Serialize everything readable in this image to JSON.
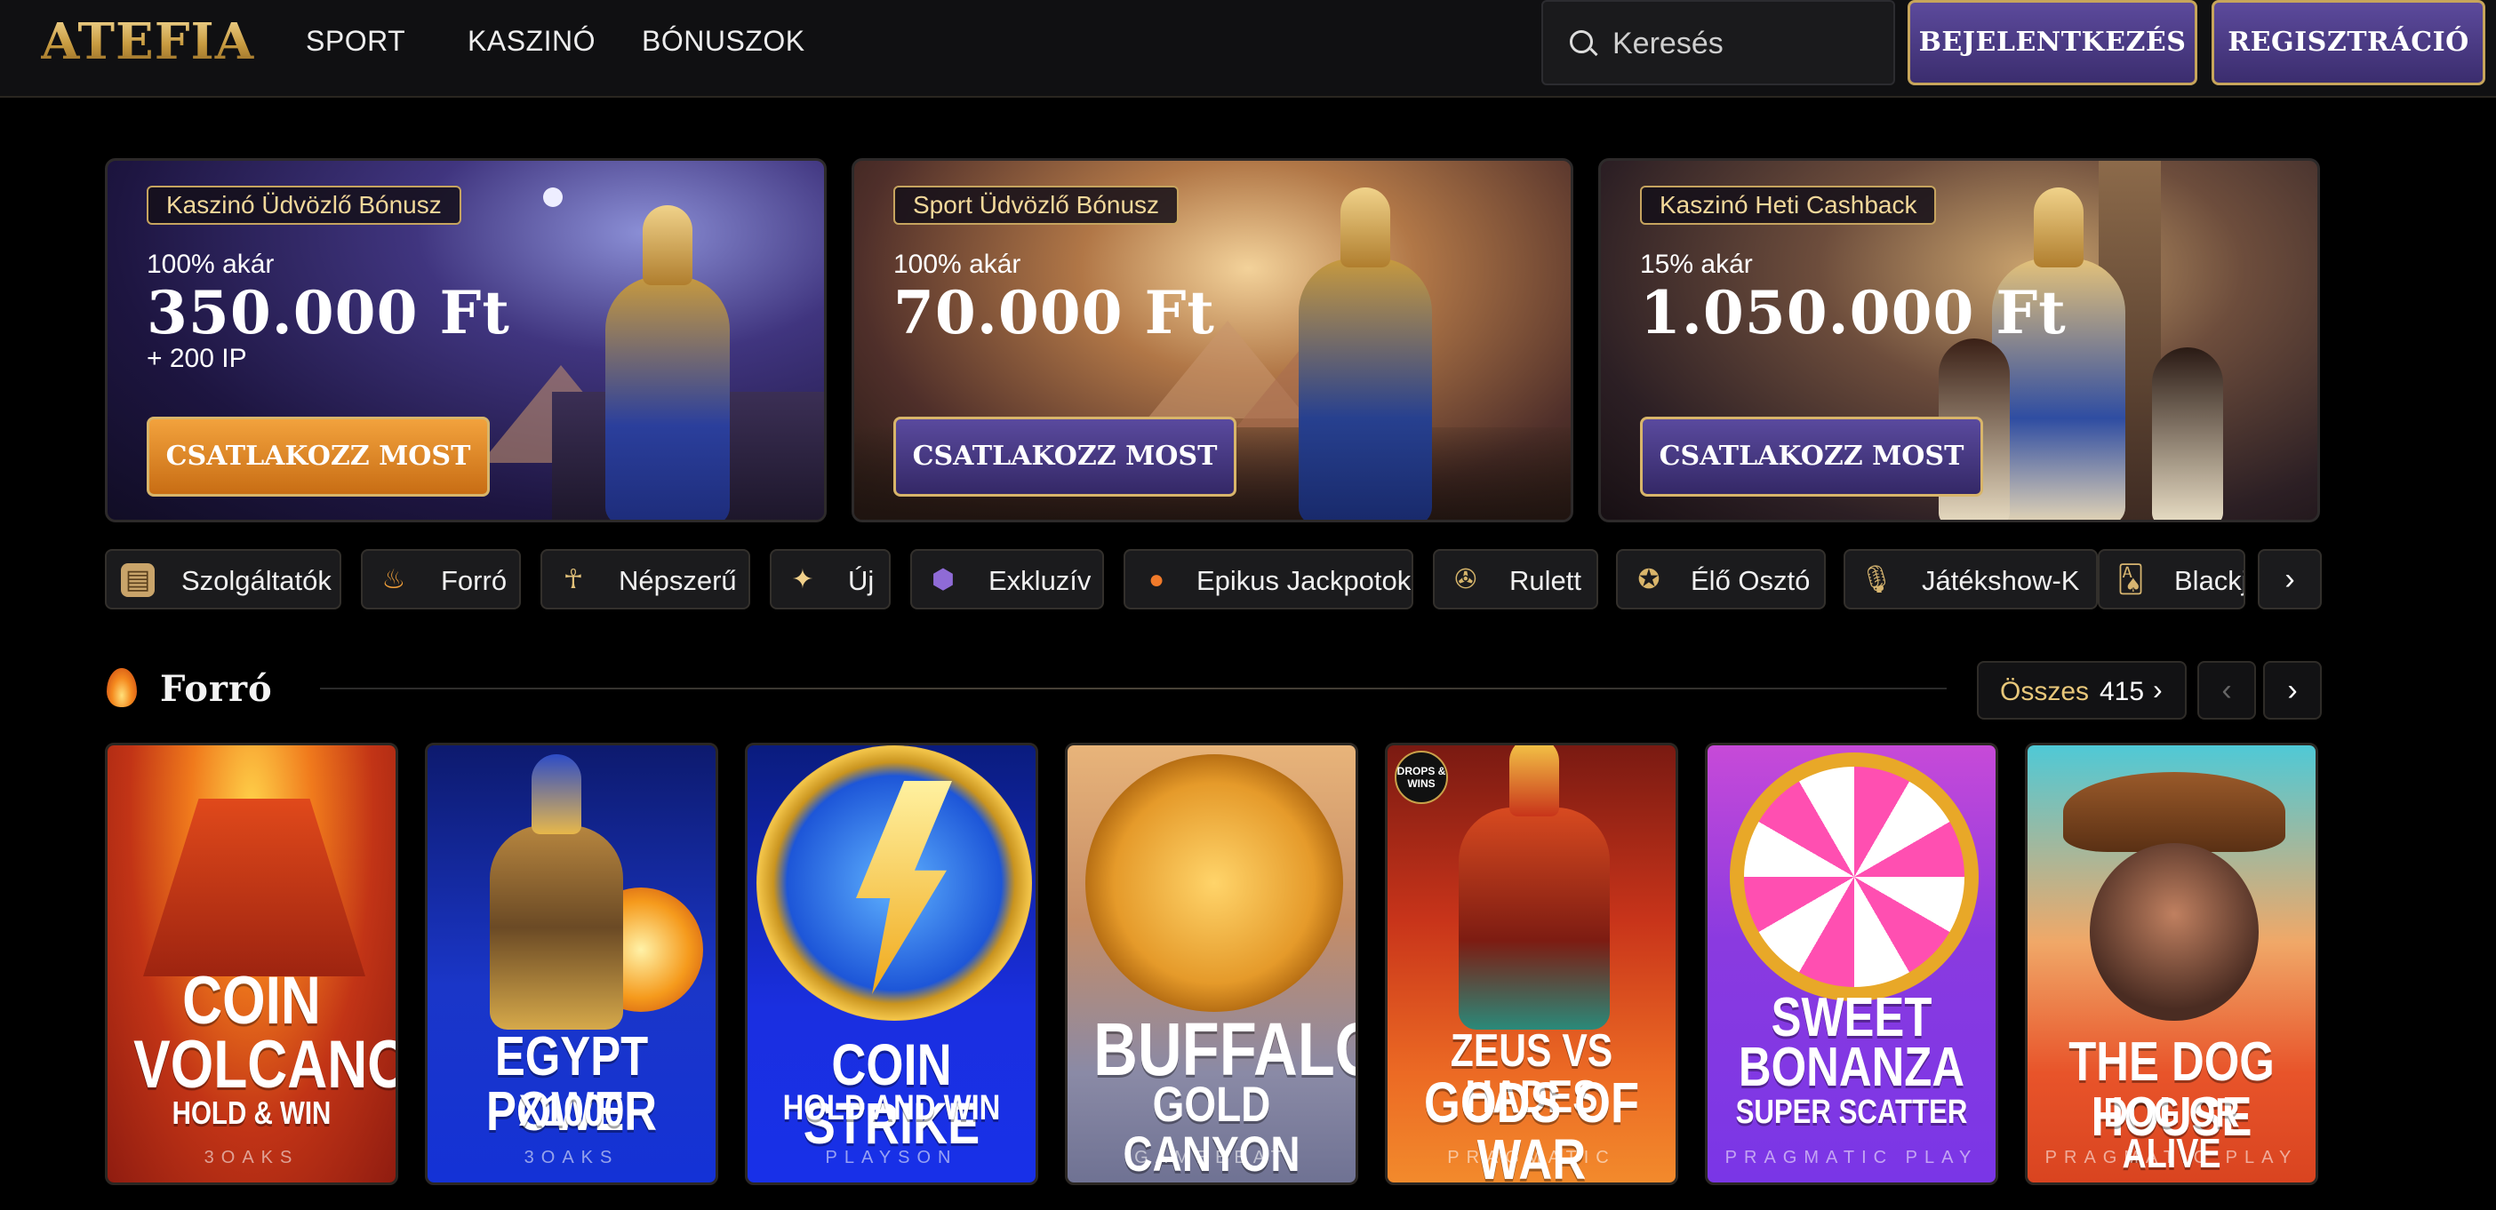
{
  "header": {
    "logo": "ATEFIA",
    "nav": [
      "SPORT",
      "KASZINÓ",
      "BÓNUSZOK"
    ],
    "search_placeholder": "Keresés",
    "login_label": "BEJELENTKEZÉS",
    "register_label": "REGISZTRÁCIÓ"
  },
  "banners": [
    {
      "tag": "Kaszinó Üdvözlő Bónusz",
      "prefix": "100% akár",
      "amount": "350.000 Ft",
      "extra": "+ 200 IP",
      "cta": "CSATLAKOZZ MOST"
    },
    {
      "tag": "Sport Üdvözlő Bónusz",
      "prefix": "100% akár",
      "amount": "70.000 Ft",
      "extra": "",
      "cta": "CSATLAKOZZ MOST"
    },
    {
      "tag": "Kaszinó Heti Cashback",
      "prefix": "15% akár",
      "amount": "1.050.000 Ft",
      "extra": "",
      "cta": "CSATLAKOZZ MOST"
    }
  ],
  "categories": [
    {
      "label": "Szolgáltatók",
      "icon": "scroll-icon"
    },
    {
      "label": "Forró",
      "icon": "flame-icon"
    },
    {
      "label": "Népszerű",
      "icon": "mask-icon"
    },
    {
      "label": "Új",
      "icon": "sparkle-icon"
    },
    {
      "label": "Exkluzív",
      "icon": "gem-icon"
    },
    {
      "label": "Epikus Jackpotok",
      "icon": "fire-coin-icon"
    },
    {
      "label": "Rulett",
      "icon": "roulette-icon"
    },
    {
      "label": "Élő Osztó",
      "icon": "star-chip-icon"
    },
    {
      "label": "Játékshow-K",
      "icon": "microphone-icon"
    },
    {
      "label": "Blackj",
      "icon": "cards-icon"
    }
  ],
  "section": {
    "title": "Forró",
    "all_label": "Összes",
    "count": "415"
  },
  "games": [
    {
      "title1": "COIN",
      "title2": "VOLCANO",
      "title3": "HOLD & WIN",
      "provider": "3OAKS"
    },
    {
      "title1": "EGYPT POWER",
      "title2": "X1000",
      "title3": "",
      "provider": "3OAKS"
    },
    {
      "title1": "COIN STRIKE",
      "title2": "HOLD AND WIN",
      "title3": "",
      "provider": "PLAYSON"
    },
    {
      "title1": "BUFFALO",
      "title2": "GOLD CANYON",
      "title3": "",
      "provider": "GAMEBEAT"
    },
    {
      "title1": "ZEUS VS HADES",
      "title2": "GODS OF WAR",
      "title3": "",
      "provider": "PRAGMATIC",
      "badge": "DROPS & WINS"
    },
    {
      "title1": "SWEET",
      "title2": "BONANZA",
      "title3": "SUPER SCATTER",
      "provider": "PRAGMATIC PLAY"
    },
    {
      "title1": "THE DOG HOUSE",
      "title2": "DOG OR ALIVE",
      "title3": "",
      "provider": "PRAGMATIC PLAY"
    }
  ]
}
